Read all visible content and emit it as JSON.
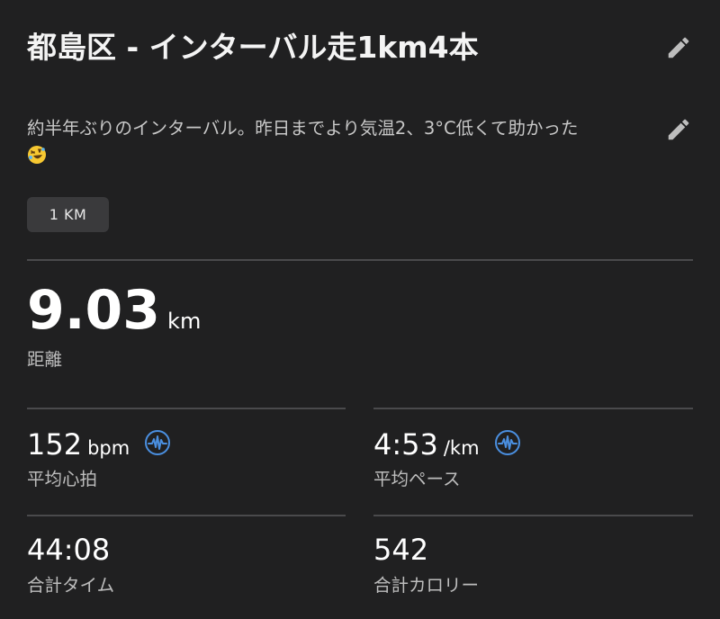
{
  "activity": {
    "title": "都島区 - インターバル走1km4本",
    "description": "約半年ぶりのインターバル。昨日までより気温2、3°C低くて助かった",
    "description_emoji": "rolling-on-floor-laughing-emoji",
    "tag": "1 KM"
  },
  "distance": {
    "value": "9.03",
    "unit": "km",
    "label": "距離"
  },
  "stats": {
    "heart_rate": {
      "value": "152",
      "unit": "bpm",
      "label": "平均心拍",
      "icon": "heart-rate-pulse-icon"
    },
    "pace": {
      "value": "4:53",
      "unit": "/km",
      "label": "平均ペース",
      "icon": "heart-rate-pulse-icon"
    },
    "time": {
      "value": "44:08",
      "label": "合計タイム"
    },
    "calories": {
      "value": "542",
      "label": "合計カロリー"
    }
  },
  "colors": {
    "background": "#202021",
    "accent_icon": "#4a8fe0",
    "divider": "#4a4a4c",
    "tag_bg": "#3a3a3c"
  },
  "icons": [
    "pencil-icon",
    "heart-rate-pulse-icon"
  ]
}
